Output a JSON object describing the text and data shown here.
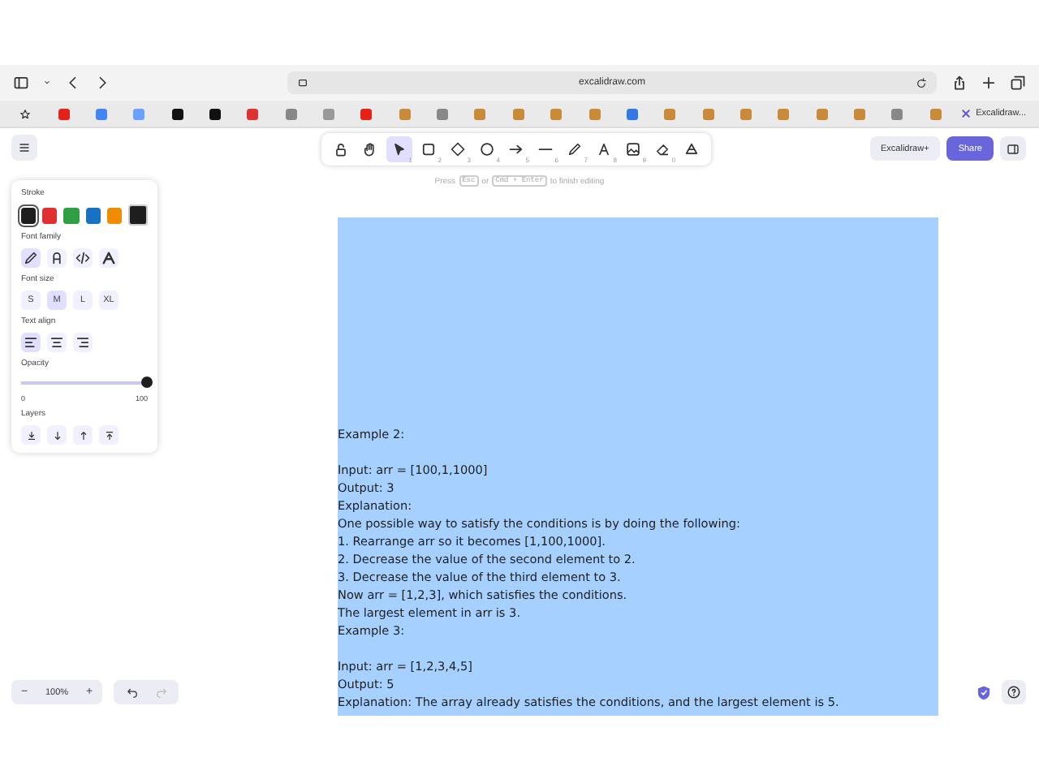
{
  "browser": {
    "address": "excalidraw.com",
    "tab_title": "Excalidraw..."
  },
  "toolbar": {
    "tools": [
      {
        "kind": "lock",
        "selected": false
      },
      {
        "kind": "hand",
        "selected": false
      },
      {
        "kind": "select",
        "shortcut": "1",
        "selected": true
      },
      {
        "kind": "rectangle",
        "shortcut": "2",
        "selected": false
      },
      {
        "kind": "diamond",
        "shortcut": "3",
        "selected": false
      },
      {
        "kind": "ellipse",
        "shortcut": "4",
        "selected": false
      },
      {
        "kind": "arrow",
        "shortcut": "5",
        "selected": false
      },
      {
        "kind": "line",
        "shortcut": "6",
        "selected": false
      },
      {
        "kind": "pencil",
        "shortcut": "7",
        "selected": false
      },
      {
        "kind": "text",
        "shortcut": "8",
        "selected": false
      },
      {
        "kind": "image",
        "shortcut": "9",
        "selected": false
      },
      {
        "kind": "eraser",
        "shortcut": "0",
        "selected": false
      },
      {
        "kind": "more",
        "selected": false
      }
    ],
    "hint": {
      "before": "Press",
      "key1": "Esc",
      "middle": "or",
      "key2": "Cmd + Enter",
      "after": "to finish editing"
    }
  },
  "top_right": {
    "plus_button": "Excalidraw+",
    "share_button": "Share"
  },
  "panel": {
    "stroke_label": "Stroke",
    "stroke_colors": [
      {
        "color": "#1e1e1e",
        "selected": true
      },
      {
        "color": "#e03131",
        "selected": false
      },
      {
        "color": "#2f9e44",
        "selected": false
      },
      {
        "color": "#1971c2",
        "selected": false
      },
      {
        "color": "#f08c00",
        "selected": false
      }
    ],
    "current_color": {
      "color": "#1e1e1e"
    },
    "font_family_label": "Font family",
    "font_families": [
      {
        "kind": "hand",
        "selected": true
      },
      {
        "kind": "normal",
        "selected": false
      },
      {
        "kind": "code",
        "selected": false
      },
      {
        "kind": "library",
        "selected": false
      }
    ],
    "font_size_label": "Font size",
    "font_sizes": [
      {
        "label": "S",
        "selected": false
      },
      {
        "label": "M",
        "selected": true
      },
      {
        "label": "L",
        "selected": false
      },
      {
        "label": "XL",
        "selected": false
      }
    ],
    "text_align_label": "Text align",
    "text_aligns": [
      {
        "kind": "left",
        "selected": true
      },
      {
        "kind": "center",
        "selected": false
      },
      {
        "kind": "right",
        "selected": false
      }
    ],
    "opacity_label": "Opacity",
    "opacity": {
      "level": 1,
      "min": "0",
      "max": "100"
    },
    "layers_label": "Layers"
  },
  "canvas_text": {
    "blocks": [
      [
        "Example 2:"
      ],
      [
        "Input: arr = [100,1,1000]",
        "Output: 3",
        "Explanation:",
        "One possible way to satisfy the conditions is by doing the following:",
        "1. Rearrange arr so it becomes [1,100,1000].",
        "2. Decrease the value of the second element to 2.",
        "3. Decrease the value of the third element to 3.",
        "Now arr = [1,2,3], which satisfies the conditions.",
        "The largest element in arr is 3.",
        "Example 3:"
      ],
      [
        "Input: arr = [1,2,3,4,5]",
        "Output: 5",
        "Explanation: The array already satisfies the conditions, and the largest element is 5."
      ]
    ]
  },
  "zoom": {
    "minus": "−",
    "value": "100%",
    "plus": "+"
  }
}
